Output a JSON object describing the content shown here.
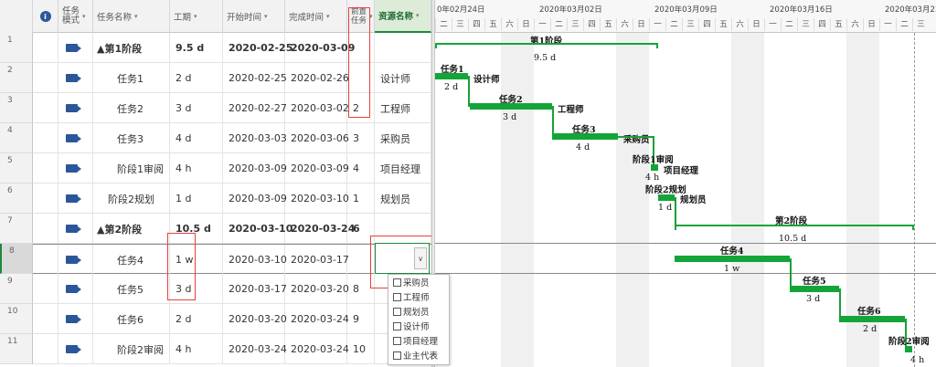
{
  "headers": {
    "info": "ℹ",
    "mode": "任务\n模式",
    "name": "任务名称",
    "duration": "工期",
    "start": "开始时间",
    "finish": "完成时间",
    "pred": "前置\n任务",
    "resource": "资源名称"
  },
  "rows": [
    {
      "num": "1",
      "name": "▲第1阶段",
      "duration": "9.5 d",
      "start": "2020-02-25",
      "finish": "2020-03-09",
      "pred": "",
      "resource": "",
      "summary": true,
      "indent": 0
    },
    {
      "num": "2",
      "name": "任务1",
      "duration": "2 d",
      "start": "2020-02-25",
      "finish": "2020-02-26",
      "pred": "",
      "resource": "设计师",
      "summary": false,
      "indent": 1
    },
    {
      "num": "3",
      "name": "任务2",
      "duration": "3 d",
      "start": "2020-02-27",
      "finish": "2020-03-02",
      "pred": "2",
      "resource": "工程师",
      "summary": false,
      "indent": 1
    },
    {
      "num": "4",
      "name": "任务3",
      "duration": "4 d",
      "start": "2020-03-03",
      "finish": "2020-03-06",
      "pred": "3",
      "resource": "采购员",
      "summary": false,
      "indent": 1
    },
    {
      "num": "5",
      "name": "阶段1审阅",
      "duration": "4 h",
      "start": "2020-03-09",
      "finish": "2020-03-09",
      "pred": "4",
      "resource": "项目经理",
      "summary": false,
      "indent": 1
    },
    {
      "num": "6",
      "name": "阶段2规划",
      "duration": "1 d",
      "start": "2020-03-09",
      "finish": "2020-03-10",
      "pred": "1",
      "resource": "规划员",
      "summary": false,
      "indent": 0.5
    },
    {
      "num": "7",
      "name": "▲第2阶段",
      "duration": "10.5 d",
      "start": "2020-03-10",
      "finish": "2020-03-24",
      "pred": "6",
      "resource": "",
      "summary": true,
      "indent": 0
    },
    {
      "num": "8",
      "name": "任务4",
      "duration": "1 w",
      "start": "2020-03-10",
      "finish": "2020-03-17",
      "pred": "",
      "resource": "",
      "summary": false,
      "indent": 1
    },
    {
      "num": "9",
      "name": "任务5",
      "duration": "3 d",
      "start": "2020-03-17",
      "finish": "2020-03-20",
      "pred": "8",
      "resource": "",
      "summary": false,
      "indent": 1
    },
    {
      "num": "10",
      "name": "任务6",
      "duration": "2 d",
      "start": "2020-03-20",
      "finish": "2020-03-24",
      "pred": "9",
      "resource": "",
      "summary": false,
      "indent": 1
    },
    {
      "num": "11",
      "name": "阶段2审阅",
      "duration": "4 h",
      "start": "2020-03-24",
      "finish": "2020-03-24",
      "pred": "10",
      "resource": "",
      "summary": false,
      "indent": 1
    }
  ],
  "timeline": {
    "weeks": [
      "0年02月24日",
      "2020年03月02日",
      "2020年03月09日",
      "2020年03月16日",
      "2020年03月23日"
    ],
    "days": [
      "二",
      "三",
      "四",
      "五",
      "六",
      "日",
      "一",
      "二",
      "三",
      "四",
      "五",
      "六",
      "日",
      "一",
      "二",
      "三",
      "四",
      "五",
      "六",
      "日",
      "一",
      "二",
      "三",
      "四",
      "五",
      "六",
      "日",
      "一",
      "二",
      "三"
    ]
  },
  "gantt_labels": {
    "phase1": "第1阶段",
    "phase1_dur": "9.5 d",
    "t1": "任务1",
    "t1_dur": "2 d",
    "t1_res": "设计师",
    "t2": "任务2",
    "t2_dur": "3 d",
    "t2_res": "工程师",
    "t3": "任务3",
    "t3_dur": "4 d",
    "t3_res": "采购员",
    "r1": "阶段1审阅",
    "r1_dur": "4 h",
    "r1_res": "项目经理",
    "p2": "阶段2规划",
    "p2_dur": "1 d",
    "p2_res": "规划员",
    "phase2": "第2阶段",
    "phase2_dur": "10.5 d",
    "t4": "任务4",
    "t4_dur": "1 w",
    "t5": "任务5",
    "t5_dur": "3 d",
    "t6": "任务6",
    "t6_dur": "2 d",
    "r2": "阶段2审阅",
    "r2_dur": "4 h"
  },
  "dropdown": {
    "options": [
      "采购员",
      "工程师",
      "规划员",
      "设计师",
      "项目经理",
      "业主代表"
    ]
  },
  "colors": {
    "bar": "#13a538",
    "highlight": "#e8403c"
  }
}
